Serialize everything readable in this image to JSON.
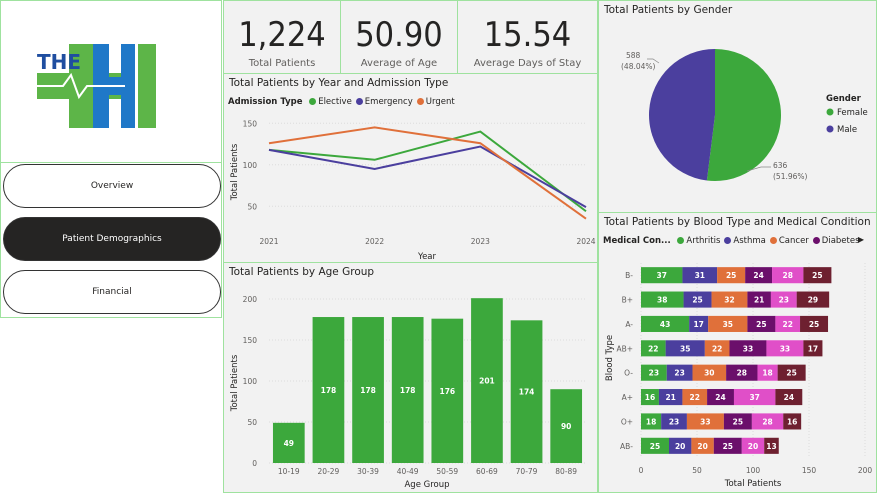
{
  "logo": {
    "text": "THE",
    "color_green": "#5db548",
    "color_blue": "#1f78c8"
  },
  "nav": [
    {
      "label": "Overview",
      "active": false
    },
    {
      "label": "Patient Demographics",
      "active": true
    },
    {
      "label": "Financial",
      "active": false
    }
  ],
  "kpis": [
    {
      "value": "1,224",
      "label": "Total Patients"
    },
    {
      "value": "50.90",
      "label": "Average of Age"
    },
    {
      "value": "15.54",
      "label": "Average Days of Stay"
    }
  ],
  "line_chart": {
    "title": "Total Patients by Year and Admission Type",
    "legend_title": "Admission Type",
    "xlabel": "Year",
    "ylabel": "Total Patients",
    "chart_data": {
      "type": "line",
      "x": [
        "2021",
        "2022",
        "2023",
        "2024"
      ],
      "yticks": [
        "50",
        "100",
        "150"
      ],
      "ylim": [
        25,
        160
      ],
      "series": [
        {
          "name": "Elective",
          "color": "#3ca83c",
          "values": [
            118,
            106,
            140,
            44
          ]
        },
        {
          "name": "Emergency",
          "color": "#4b3f9e",
          "values": [
            118,
            95,
            122,
            49
          ]
        },
        {
          "name": "Urgent",
          "color": "#e0703a",
          "values": [
            126,
            145,
            126,
            35
          ]
        }
      ]
    }
  },
  "pie_chart": {
    "title": "Total Patients by Gender",
    "legend_title": "Gender",
    "chart_data": {
      "type": "pie",
      "slices": [
        {
          "name": "Female",
          "value": 636,
          "pct": "(51.96%)",
          "color": "#3ca83c"
        },
        {
          "name": "Male",
          "value": 588,
          "pct": "(48.04%)",
          "color": "#4b3f9e"
        }
      ]
    }
  },
  "bar_chart": {
    "title": "Total Patients by Age Group",
    "xlabel": "Age Group",
    "ylabel": "Total Patients",
    "chart_data": {
      "type": "bar",
      "categories": [
        "10-19",
        "20-29",
        "30-39",
        "40-49",
        "50-59",
        "60-69",
        "70-79",
        "80-89"
      ],
      "values": [
        49,
        178,
        178,
        178,
        176,
        201,
        174,
        90
      ],
      "yticks": [
        "0",
        "50",
        "100",
        "150",
        "200"
      ],
      "ylim": [
        0,
        200
      ],
      "color": "#3ca83c"
    }
  },
  "stacked_chart": {
    "title": "Total Patients by Blood Type and Medical Condition",
    "legend_title": "Medical Con...",
    "ylabel": "Blood Type",
    "xlabel": "Total Patients",
    "chart_data": {
      "type": "bar",
      "orientation": "horizontal-stacked",
      "categories": [
        "B-",
        "B+",
        "A-",
        "AB+",
        "O-",
        "A+",
        "O+",
        "AB-"
      ],
      "xticks": [
        "0",
        "50",
        "100",
        "150",
        "200"
      ],
      "xlim": [
        0,
        200
      ],
      "series": [
        {
          "name": "Arthritis",
          "color": "#3ca83c",
          "values": [
            37,
            38,
            43,
            22,
            23,
            16,
            18,
            25
          ]
        },
        {
          "name": "Asthma",
          "color": "#4b3f9e",
          "values": [
            31,
            25,
            17,
            35,
            23,
            21,
            23,
            20
          ]
        },
        {
          "name": "Cancer",
          "color": "#e0703a",
          "values": [
            25,
            32,
            35,
            22,
            30,
            22,
            33,
            20
          ]
        },
        {
          "name": "Diabetes",
          "color": "#6b0f6b",
          "values": [
            24,
            21,
            25,
            33,
            28,
            24,
            25,
            25
          ]
        },
        {
          "name": "",
          "color": "#e04fc8",
          "values": [
            28,
            23,
            22,
            33,
            18,
            37,
            28,
            20
          ]
        },
        {
          "name": "",
          "color": "#6e2030",
          "values": [
            25,
            29,
            25,
            17,
            25,
            24,
            16,
            13
          ]
        }
      ]
    }
  }
}
